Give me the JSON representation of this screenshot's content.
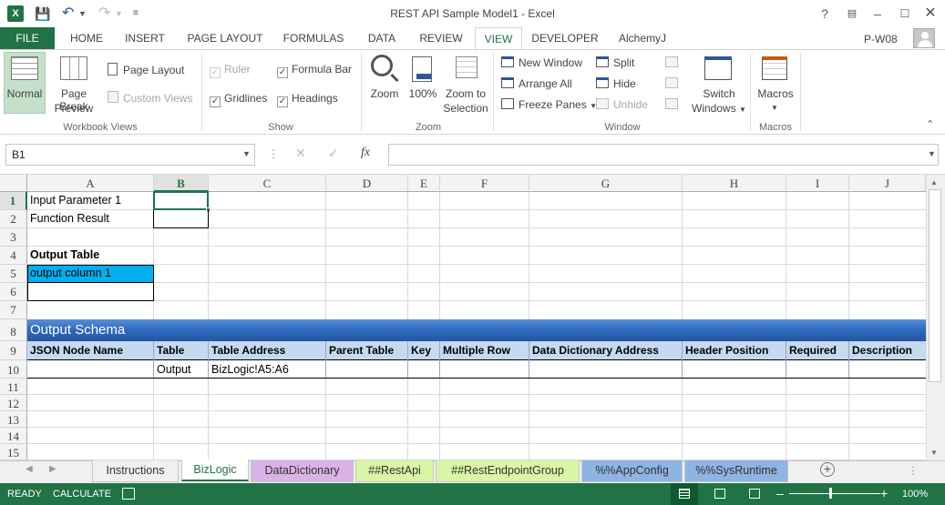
{
  "window": {
    "title": "REST API Sample Model1 - Excel",
    "user": "P-W08"
  },
  "ribbon_tabs": [
    "HOME",
    "INSERT",
    "PAGE LAYOUT",
    "FORMULAS",
    "DATA",
    "REVIEW",
    "VIEW",
    "DEVELOPER",
    "AlchemyJ"
  ],
  "file_tab": "FILE",
  "active_tab": "VIEW",
  "groups": {
    "workbook_views": {
      "label": "Workbook Views",
      "normal": "Normal",
      "page_break_1": "Page Break",
      "page_break_2": "Preview",
      "page_layout": "Page Layout",
      "custom_views": "Custom Views"
    },
    "show": {
      "label": "Show",
      "ruler": "Ruler",
      "formula_bar": "Formula Bar",
      "gridlines": "Gridlines",
      "headings": "Headings"
    },
    "zoom": {
      "label": "Zoom",
      "zoom": "Zoom",
      "zoom100": "100%",
      "zoom_sel_1": "Zoom to",
      "zoom_sel_2": "Selection"
    },
    "window": {
      "label": "Window",
      "new_window": "New Window",
      "arrange_all": "Arrange All",
      "freeze_panes": "Freeze Panes",
      "split": "Split",
      "hide": "Hide",
      "unhide": "Unhide",
      "switch_1": "Switch",
      "switch_2": "Windows"
    },
    "macros": {
      "label": "Macros",
      "macros": "Macros"
    }
  },
  "formula_bar": {
    "name_box": "B1",
    "formula": ""
  },
  "columns": [
    "A",
    "B",
    "C",
    "D",
    "E",
    "F",
    "G",
    "H",
    "I",
    "J"
  ],
  "rows": [
    "1",
    "2",
    "3",
    "4",
    "5",
    "6",
    "7",
    "8",
    "9",
    "10",
    "11",
    "12",
    "13",
    "14",
    "15"
  ],
  "cells": {
    "a1": "Input Parameter 1",
    "a2": "Function Result",
    "a4": "Output Table",
    "a5": "output column 1",
    "a8": "Output Schema",
    "h9": [
      "JSON Node Name",
      "Table",
      "Table Address",
      "Parent Table",
      "Key",
      "Multiple Row",
      "Data Dictionary Address",
      "Header Position",
      "Required",
      "Description"
    ],
    "b10": "Output",
    "c10": "BizLogic!A5:A6"
  },
  "sheet_tabs": [
    {
      "label": "Instructions",
      "color": "#f0f0f0",
      "active": false
    },
    {
      "label": "BizLogic",
      "color": "#ffffff",
      "active": true
    },
    {
      "label": "DataDictionary",
      "color": "#d9b3e6",
      "active": false
    },
    {
      "label": "##RestApi",
      "color": "#d9f5a6",
      "active": false
    },
    {
      "label": "##RestEndpointGroup",
      "color": "#d9f5a6",
      "active": false
    },
    {
      "label": "%%AppConfig",
      "color": "#8db4e2",
      "active": false
    },
    {
      "label": "%%SysRuntime",
      "color": "#8db4e2",
      "active": false
    }
  ],
  "status": {
    "ready": "READY",
    "calculate": "CALCULATE",
    "zoom": "100%"
  },
  "colors": {
    "excel_green": "#217346",
    "schema_blue": "#2e6bc4",
    "header_light_blue": "#c5d9f1",
    "cyan_cell": "#00b0f0"
  }
}
